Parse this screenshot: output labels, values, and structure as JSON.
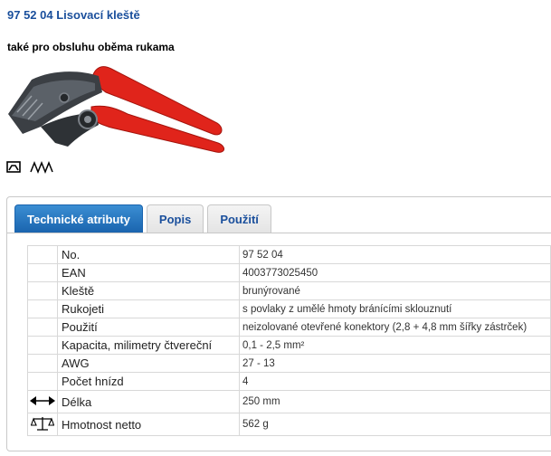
{
  "product": {
    "title": "97 52 04 Lisovací kleště",
    "subtitle": "také pro obsluhu oběma rukama",
    "image_icon": "crimping-pliers-image",
    "feature_icons": [
      "crimp-profile-icon",
      "zigzag-jaws-icon"
    ]
  },
  "tabs": [
    {
      "label": "Technické atributy",
      "active": true
    },
    {
      "label": "Popis",
      "active": false
    },
    {
      "label": "Použití",
      "active": false
    }
  ],
  "attributes": [
    {
      "label": "No.",
      "value": "97 52 04",
      "icon": ""
    },
    {
      "label": "EAN",
      "value": "4003773025450",
      "icon": ""
    },
    {
      "label": "Kleště",
      "value": "brunýrované",
      "icon": ""
    },
    {
      "label": "Rukojeti",
      "value": "s povlaky z umělé hmoty bránícími sklouznutí",
      "icon": ""
    },
    {
      "label": "Použití",
      "value": "neizolované otevřené konektory (2,8 + 4,8 mm šířky zástrček)",
      "icon": ""
    },
    {
      "label": "Kapacita, milimetry čtvereční",
      "value": "0,1 - 2,5 mm²",
      "icon": ""
    },
    {
      "label": "AWG",
      "value": "27 - 13",
      "icon": ""
    },
    {
      "label": "Počet hnízd",
      "value": "4",
      "icon": ""
    },
    {
      "label": "Délka",
      "value": "250 mm",
      "icon": "length-arrow-icon"
    },
    {
      "label": "Hmotnost netto",
      "value": "562 g",
      "icon": "scale-icon"
    }
  ],
  "colors": {
    "title": "#1a4f9c",
    "tab_active": "#1a64ae",
    "handle_red": "#e0241b"
  }
}
